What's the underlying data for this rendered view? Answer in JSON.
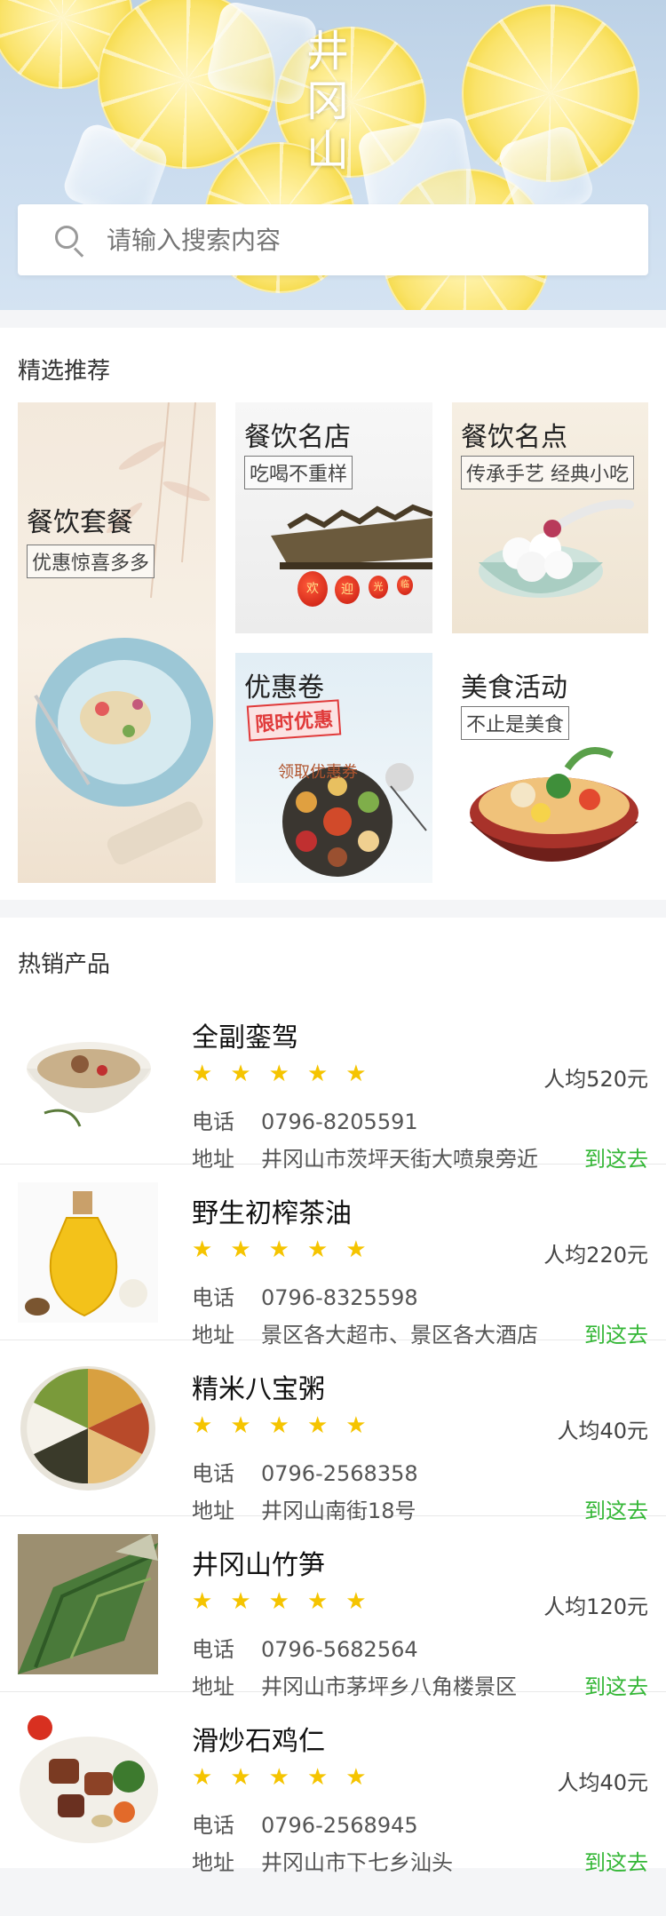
{
  "hero": {
    "title_chars": [
      "井",
      "冈",
      "山"
    ]
  },
  "search": {
    "placeholder": "请输入搜索内容",
    "icon": "search-icon"
  },
  "recommend": {
    "title": "精选推荐",
    "cards": [
      {
        "name": "餐饮套餐",
        "tag": "优惠惊喜多多"
      },
      {
        "name": "餐饮名店",
        "tag": "吃喝不重样"
      },
      {
        "name": "餐饮名点",
        "tag": "传承手艺 经典小吃"
      },
      {
        "name": "优惠卷",
        "badge": "限时优惠",
        "coupon_text": "领取优惠券"
      },
      {
        "name": "美食活动",
        "tag": "不止是美食"
      }
    ],
    "lanterns": [
      "欢",
      "迎",
      "光",
      "临"
    ]
  },
  "hot": {
    "title": "热销产品",
    "phone_label": "电话",
    "addr_label": "地址",
    "go_label": "到这去",
    "star_color": "#f5c400",
    "go_color": "#35b737",
    "products": [
      {
        "name": "全副銮驾",
        "rating": 5,
        "avg": "人均520元",
        "phone": "0796-8205591",
        "address": "井冈山市茨坪天街大喷泉旁近"
      },
      {
        "name": "野生初榨茶油",
        "rating": 5,
        "avg": "人均220元",
        "phone": "0796-8325598",
        "address": "景区各大超市、景区各大酒店"
      },
      {
        "name": "精米八宝粥",
        "rating": 5,
        "avg": "人均40元",
        "phone": "0796-2568358",
        "address": "井冈山南街18号"
      },
      {
        "name": "井冈山竹笋",
        "rating": 5,
        "avg": "人均120元",
        "phone": "0796-5682564",
        "address": "井冈山市茅坪乡八角楼景区"
      },
      {
        "name": "滑炒石鸡仁",
        "rating": 5,
        "avg": "人均40元",
        "phone": "0796-2568945",
        "address": "井冈山市下七乡汕头"
      }
    ]
  }
}
